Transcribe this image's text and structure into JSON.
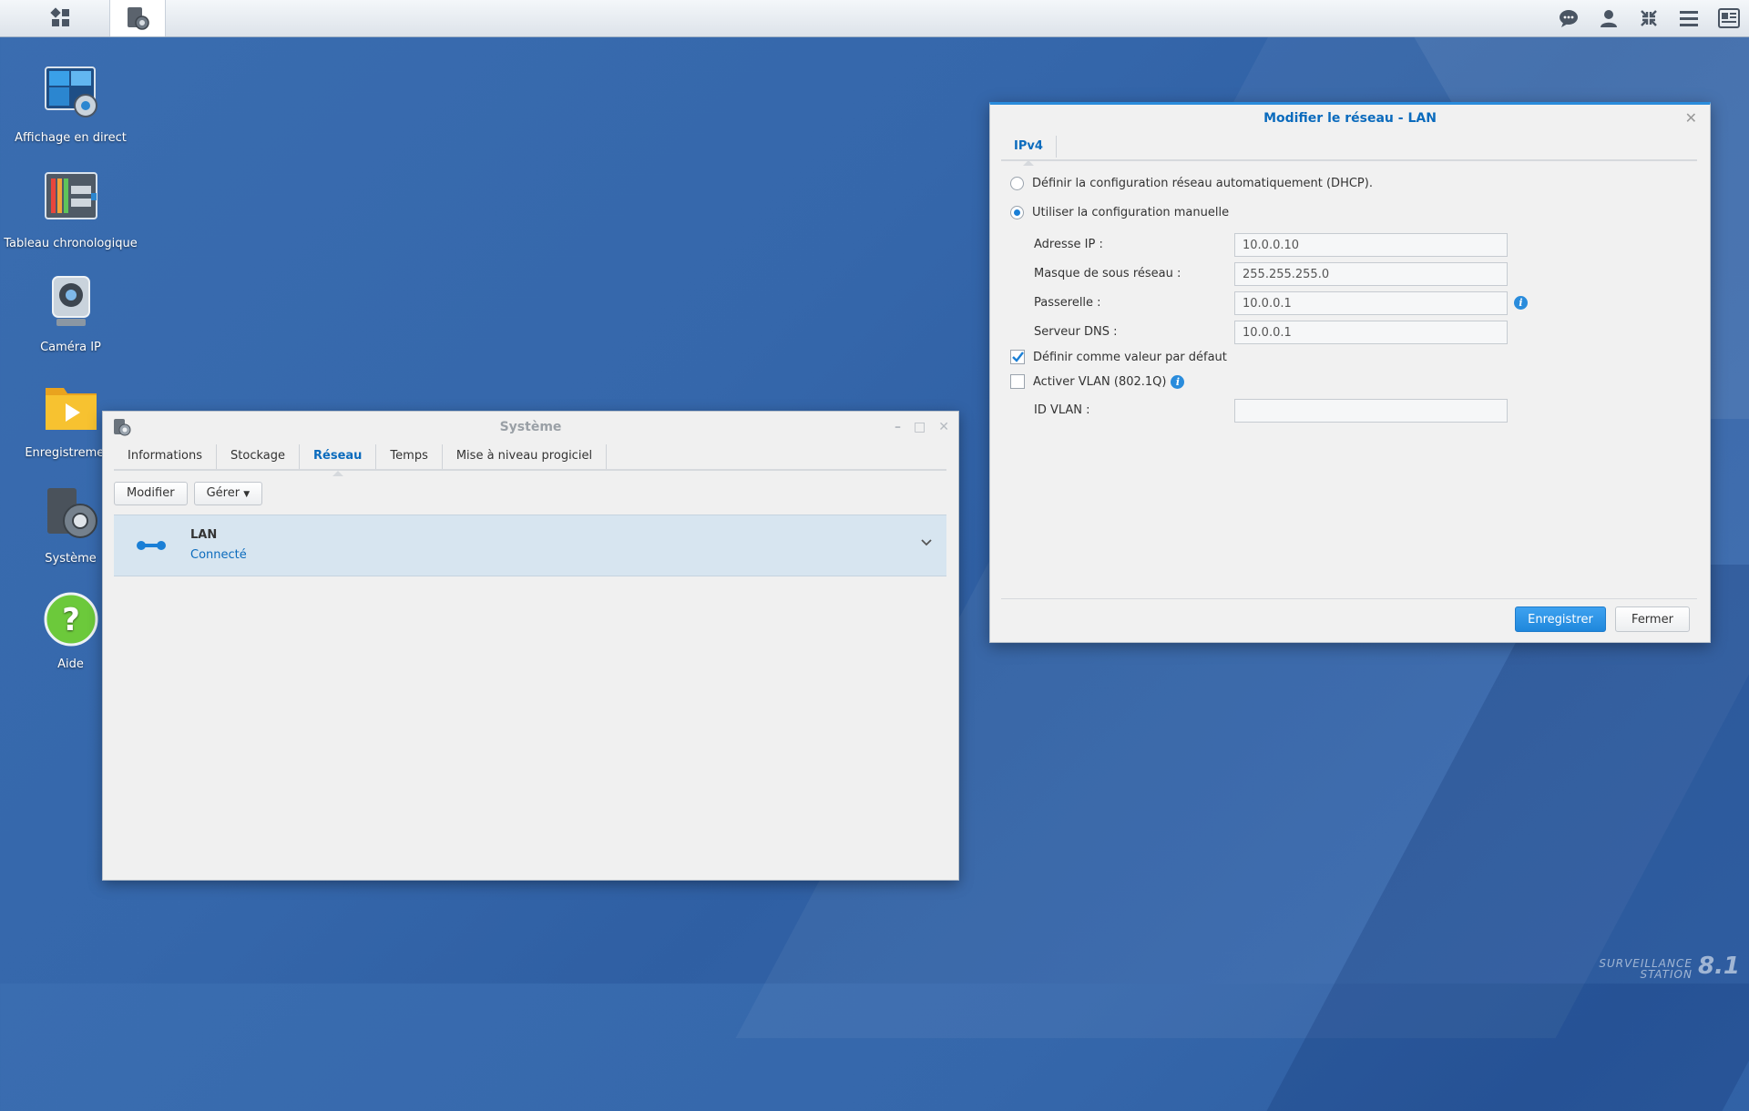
{
  "desktop": {
    "icons": [
      {
        "label": "Affichage en direct"
      },
      {
        "label": "Tableau chronologique"
      },
      {
        "label": "Caméra IP"
      },
      {
        "label": "Enregistrement"
      },
      {
        "label": "Système"
      },
      {
        "label": "Aide"
      }
    ],
    "brand": {
      "line1": "SURVEILLANCE",
      "line2": "STATION",
      "version": "8.1"
    }
  },
  "taskbar": {
    "right_icons": [
      "chat-icon",
      "user-icon",
      "compress-icon",
      "menu-icon",
      "widgets-icon"
    ]
  },
  "system_window": {
    "title": "Système",
    "tabs": [
      "Informations",
      "Stockage",
      "Réseau",
      "Temps",
      "Mise à niveau progiciel"
    ],
    "active_tab": "Réseau",
    "toolbar": {
      "modify": "Modifier",
      "manage": "Gérer"
    },
    "network": {
      "name": "LAN",
      "status": "Connecté"
    }
  },
  "edit_dialog": {
    "title": "Modifier le réseau - LAN",
    "tab": "IPv4",
    "option_dhcp": "Définir la configuration réseau automatiquement (DHCP).",
    "option_manual": "Utiliser la configuration manuelle",
    "fields": {
      "ip_label": "Adresse IP :",
      "ip_value": "10.0.0.10",
      "mask_label": "Masque de sous réseau :",
      "mask_value": "255.255.255.0",
      "gateway_label": "Passerelle :",
      "gateway_value": "10.0.0.1",
      "dns_label": "Serveur DNS :",
      "dns_value": "10.0.0.1",
      "vlan_id_label": "ID VLAN :",
      "vlan_id_value": ""
    },
    "default_label": "Définir comme valeur par défaut",
    "default_checked": true,
    "vlan_label": "Activer VLAN (802.1Q)",
    "vlan_checked": false,
    "save": "Enregistrer",
    "close": "Fermer"
  }
}
